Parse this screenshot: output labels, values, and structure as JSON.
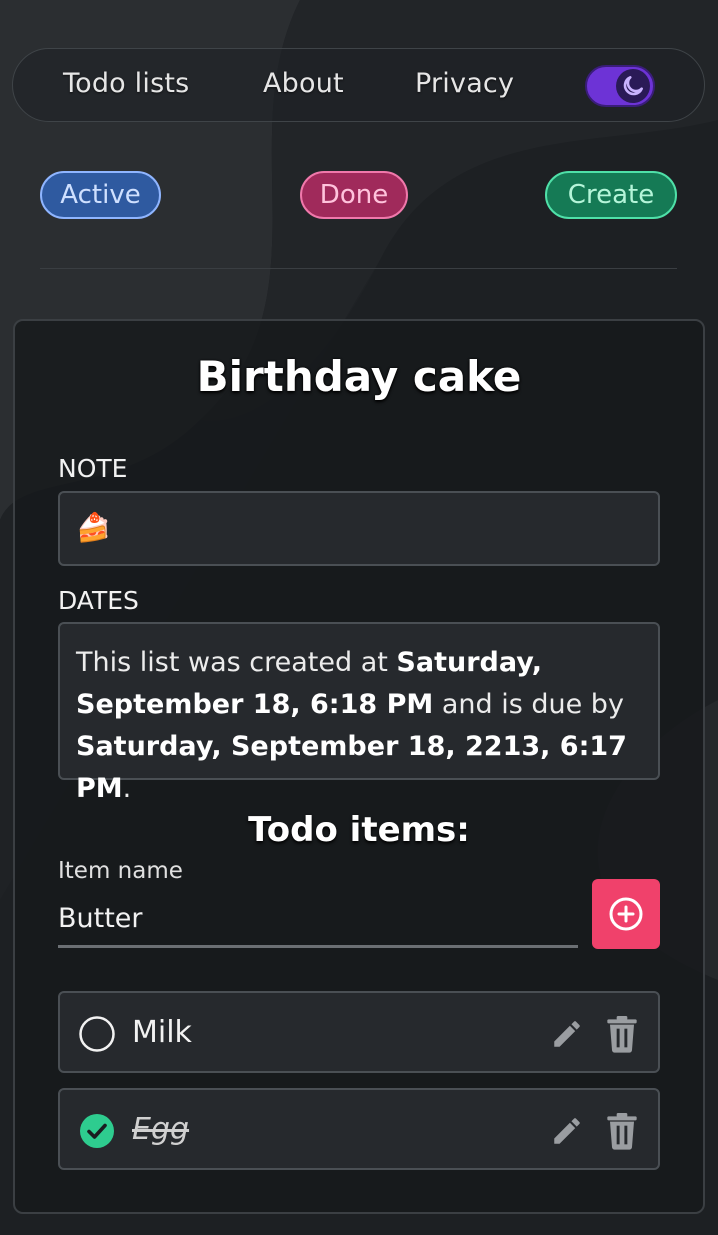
{
  "nav": {
    "links": [
      "Todo lists",
      "About",
      "Privacy"
    ],
    "theme_toggle_icon": "moon-icon"
  },
  "filters": {
    "active": "Active",
    "done": "Done",
    "create": "Create"
  },
  "list": {
    "title": "Birthday cake",
    "note_label": "NOTE",
    "note_value": "🍰",
    "dates_label": "DATES",
    "dates": {
      "prefix": "This list was created at ",
      "created": "Saturday, September 18, 6:18 PM",
      "middle": " and is due by ",
      "due": "Saturday, September 18, 2213, 6:17 PM",
      "suffix": "."
    }
  },
  "todo_section": {
    "title": "Todo items:",
    "input_label": "Item name",
    "input_value": "Butter",
    "add_icon": "plus-circle-icon"
  },
  "todos": [
    {
      "text": "Milk",
      "done": false
    },
    {
      "text": "Egg",
      "done": true
    }
  ],
  "colors": {
    "accent_red": "#f0416b",
    "done_green": "#2ecc8f",
    "toggle_purple": "#6d33d6"
  }
}
